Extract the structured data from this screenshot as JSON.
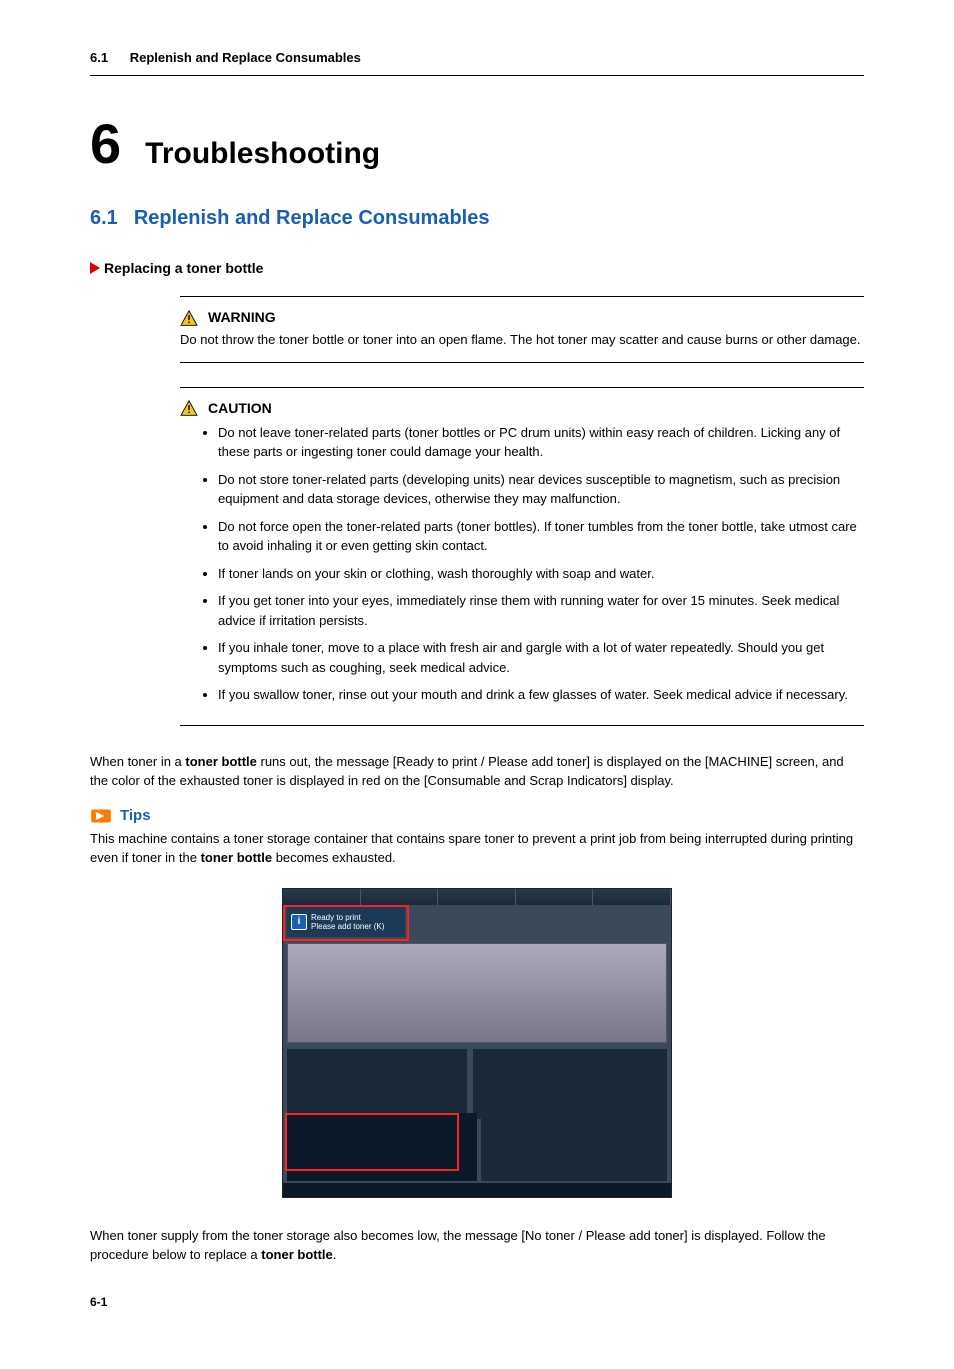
{
  "header": {
    "num": "6.1",
    "title": "Replenish and Replace Consumables"
  },
  "chapter": {
    "num": "6",
    "title": "Troubleshooting"
  },
  "section": {
    "num": "6.1",
    "title": "Replenish and Replace Consumables"
  },
  "subsection": {
    "title": "Replacing a toner bottle"
  },
  "warning": {
    "label": "WARNING",
    "body": "Do not throw the toner bottle or toner into an open flame. The hot toner may scatter and cause burns or other damage."
  },
  "caution": {
    "label": "CAUTION",
    "bullets": [
      "Do not leave toner-related parts (toner bottles or PC drum units) within easy reach of children. Licking any of these parts or ingesting toner could damage your health.",
      "Do not store toner-related parts (developing units) near devices susceptible to magnetism, such as precision equipment and data storage devices, otherwise they may malfunction.",
      "Do not force open the toner-related parts (toner bottles). If toner tumbles from the toner bottle, take utmost care to avoid inhaling it or even getting skin contact.",
      "If toner lands on your skin or clothing, wash thoroughly with soap and water.",
      "If you get toner into your eyes, immediately rinse them with running water for over 15 minutes. Seek medical advice if irritation persists.",
      "If you inhale toner, move to a place with fresh air and gargle with a lot of water repeatedly. Should you get symptoms such as coughing, seek medical advice.",
      "If you swallow toner, rinse out your mouth and drink a few glasses of water. Seek medical advice if necessary."
    ]
  },
  "para1_pre": "When toner in a ",
  "para1_b1": "toner bottle",
  "para1_post": " runs out, the message [Ready to print / Please add toner] is displayed on the [MACHINE] screen, and the color of the exhausted toner is displayed in red on the [Consumable and Scrap Indicators] display.",
  "tips": {
    "label": "Tips"
  },
  "tips_p_pre": "This machine contains a toner storage container that contains spare toner to prevent a print job from being interrupted during printing even if toner in the ",
  "tips_b1": "toner bottle",
  "tips_p_post": " becomes exhausted.",
  "screenshot": {
    "status_line1": "Ready to print",
    "status_line2": "Please add toner (K)"
  },
  "para2_pre": "When toner supply from the toner storage also becomes low, the message [No toner / Please add toner] is displayed. Follow the procedure below to replace a ",
  "para2_b1": "toner bottle",
  "para2_post": ".",
  "footer": {
    "page": "6-1"
  }
}
